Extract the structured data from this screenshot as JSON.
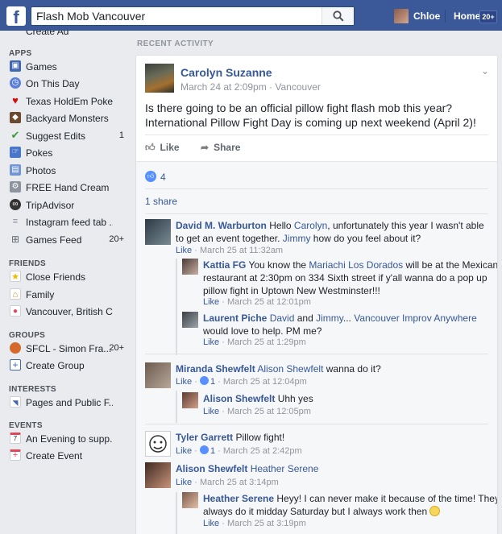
{
  "topbar": {
    "logo": "f",
    "search_value": "Flash Mob Vancouver",
    "user_name": "Chloe",
    "home_label": "Home",
    "home_badge": "20+"
  },
  "sidebar": {
    "cut_item": "Create Ad",
    "apps_title": "APPS",
    "apps": [
      {
        "label": "Games",
        "count": "",
        "icon": "games-icon"
      },
      {
        "label": "On This Day",
        "count": "",
        "icon": "clock-icon"
      },
      {
        "label": "Texas HoldEm Poker",
        "count": "",
        "icon": "heart-icon"
      },
      {
        "label": "Backyard Monsters",
        "count": "",
        "icon": "monster-icon"
      },
      {
        "label": "Suggest Edits",
        "count": "1",
        "icon": "pencil-check-icon"
      },
      {
        "label": "Pokes",
        "count": "",
        "icon": "poke-icon"
      },
      {
        "label": "Photos",
        "count": "",
        "icon": "photos-icon"
      },
      {
        "label": "FREE Hand Cream",
        "count": "",
        "icon": "app-gear-icon"
      },
      {
        "label": "TripAdvisor",
        "count": "",
        "icon": "owl-icon"
      },
      {
        "label": "Instagram feed tab ...",
        "count": "",
        "icon": "feed-icon"
      },
      {
        "label": "Games Feed",
        "count": "20+",
        "icon": "controller-icon"
      }
    ],
    "friends_title": "FRIENDS",
    "friends": [
      {
        "label": "Close Friends",
        "count": "",
        "icon": "star-icon"
      },
      {
        "label": "Family",
        "count": "",
        "icon": "house-icon"
      },
      {
        "label": "Vancouver, British C...",
        "count": "",
        "icon": "location-icon"
      }
    ],
    "groups_title": "GROUPS",
    "groups": [
      {
        "label": "SFCL - Simon Fra...",
        "count": "20+",
        "icon": "basketball-icon"
      },
      {
        "label": "Create Group",
        "count": "",
        "icon": "create-group-icon"
      }
    ],
    "interests_title": "INTERESTS",
    "interests": [
      {
        "label": "Pages and Public F...",
        "count": "",
        "icon": "rss-icon"
      }
    ],
    "events_title": "EVENTS",
    "events": [
      {
        "label": "An Evening to supp...",
        "count": "",
        "icon": "calendar-icon"
      },
      {
        "label": "Create Event",
        "count": "",
        "icon": "create-event-icon"
      }
    ]
  },
  "feed": {
    "section_title": "RECENT ACTIVITY",
    "post": {
      "author": "Carolyn Suzanne",
      "meta": "March 24 at 2:09pm · Vancouver",
      "text": "Is there going to be an official pillow fight flash mob this year? International Pillow Fight Day is coming up next weekend (April 2)!",
      "like_label": "Like",
      "share_label": "Share",
      "like_count": "4",
      "shares": "1 share"
    },
    "comments": [
      {
        "name": "David M. Warburton",
        "pre": "Hello ",
        "tag1": "Carolyn",
        "mid": ", unfortunately this year I wasn't able to get an event together. ",
        "tag2": "Jimmy",
        "post": " how do you feel about it?",
        "like": "Like",
        "meta": " · March 25 at 11:32am"
      },
      {
        "name": "Kattia FG",
        "pre": "You know the ",
        "tag1": "Mariachi Los Dorados",
        "mid": " will be at the Mexican restaurant at 2:30pm on 334 Sixth street if y'all wanna do a pop up pillow fight in Uptown New Westminster!!!",
        "like": "Like",
        "meta": " · March 25 at 12:01pm"
      },
      {
        "name": "Laurent Piche",
        "tag1": "David",
        "mid": " and ",
        "tag2": "Jimmy",
        "mid2": "... ",
        "tag3": "Vancouver Improv Anywhere",
        "post": " would love to help. PM me?",
        "like": "Like",
        "meta": " · March 25 at 1:29pm"
      },
      {
        "name": "Miranda Shewfelt",
        "tag1": "Alison Shewfelt",
        "post": " wanna do it?",
        "like": "Like",
        "likes": "1",
        "meta": " · March 25 at 12:04pm"
      },
      {
        "name": "Alison Shewfelt",
        "post": "Uhh yes",
        "like": "Like",
        "meta": " · March 25 at 12:05pm"
      },
      {
        "name": "Tyler Garrett",
        "post": "Pillow fight!",
        "like": "Like",
        "likes": "1",
        "meta": " · March 25 at 2:42pm"
      },
      {
        "name": "Alison Shewfelt",
        "tag1": "Heather Serene",
        "like": "Like",
        "meta": " · March 25 at 3:14pm"
      },
      {
        "name": "Heather Serene",
        "post": "Heyy! I can never make it because of the time! They always do it midday Saturday but I always work then",
        "like": "Like",
        "meta": " · March 25 at 3:19pm"
      }
    ]
  }
}
